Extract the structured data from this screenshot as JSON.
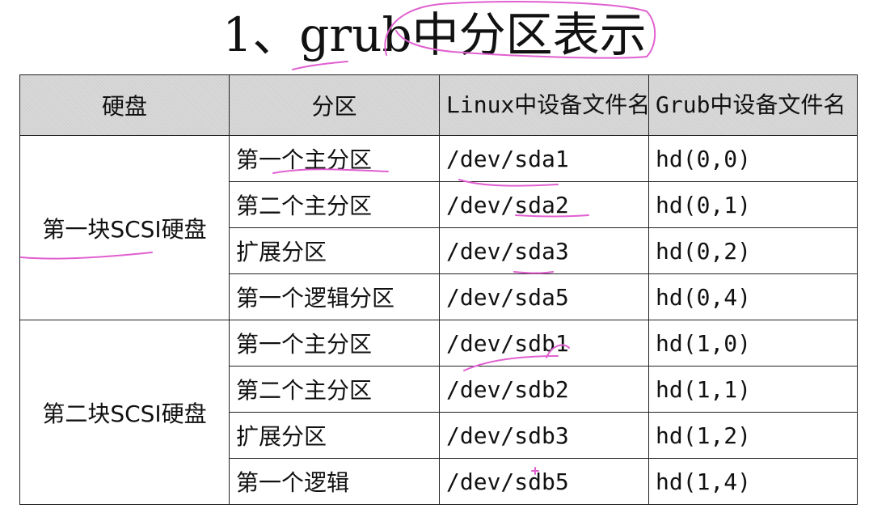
{
  "title": "1、grub中分区表示",
  "table": {
    "headers": [
      "硬盘",
      "分区",
      "Linux中设备文件名",
      "Grub中设备文件名"
    ],
    "groups": [
      {
        "disk": "第一块SCSI硬盘",
        "rows": [
          {
            "partition": "第一个主分区",
            "linux": "/dev/sda1",
            "grub": "hd(0,0)"
          },
          {
            "partition": "第二个主分区",
            "linux": "/dev/sda2",
            "grub": "hd(0,1)"
          },
          {
            "partition": "扩展分区",
            "linux": "/dev/sda3",
            "grub": "hd(0,2)"
          },
          {
            "partition": "第一个逻辑分区",
            "linux": "/dev/sda5",
            "grub": "hd(0,4)"
          }
        ]
      },
      {
        "disk": "第二块SCSI硬盘",
        "rows": [
          {
            "partition": "第一个主分区",
            "linux": "/dev/sdb1",
            "grub": "hd(1,0)"
          },
          {
            "partition": "第二个主分区",
            "linux": "/dev/sdb2",
            "grub": "hd(1,1)"
          },
          {
            "partition": "扩展分区",
            "linux": "/dev/sdb3",
            "grub": "hd(1,2)"
          },
          {
            "partition": "第一个逻辑",
            "linux": "/dev/sdb5",
            "grub": "hd(1,4)"
          }
        ]
      }
    ]
  },
  "annotation_color": "#e060d0",
  "header_bg": "#d9d9d9"
}
